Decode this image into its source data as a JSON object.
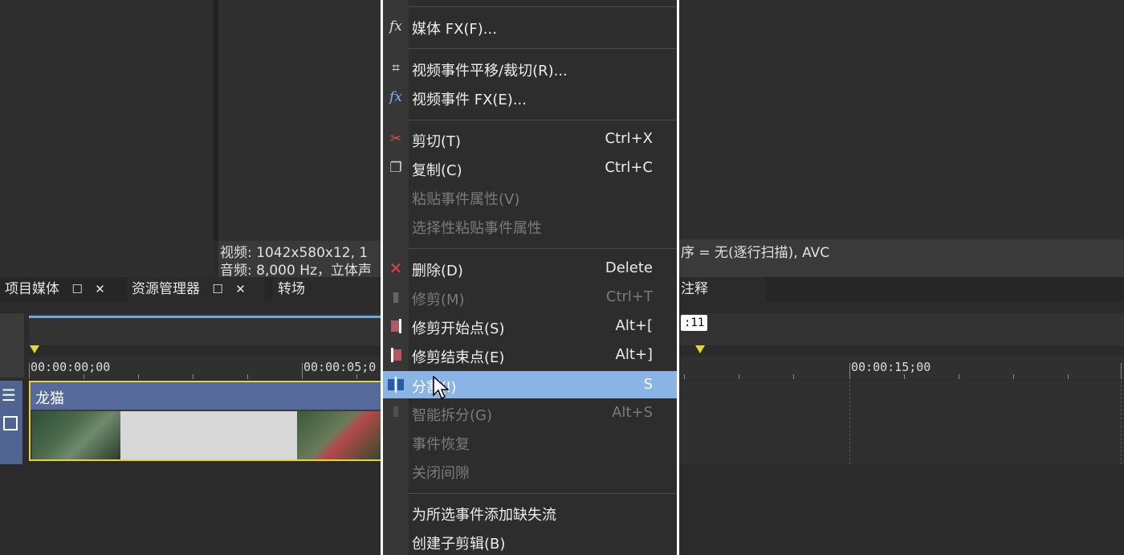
{
  "preview_info": {
    "video_left": "视频: 1042x580x12, 1",
    "audio_left": "音频: 8,000 Hz，立体声",
    "right_text": "序 = 无(逐行扫描), AVC"
  },
  "tabs": {
    "project_media": "项目媒体",
    "explorer": "资源管理器",
    "transitions": "转场",
    "notes": "注释",
    "window_glyph": "☐",
    "close_glyph": "✕"
  },
  "timeline": {
    "tc_start": "00:00:00;00",
    "tc_5": "00:00:05;0",
    "tc_15": "00:00:15;00",
    "cursor_tc": ":11",
    "track_clip_name": "龙猫"
  },
  "menu": {
    "items": [
      {
        "id": "media-fx",
        "label": "媒体 FX(F)...",
        "shortcut": "",
        "disabled": false
      },
      {
        "id": "pan-crop",
        "label": "视频事件平移/裁切(R)...",
        "shortcut": "",
        "disabled": false
      },
      {
        "id": "video-fx",
        "label": "视频事件 FX(E)...",
        "shortcut": "",
        "disabled": false
      },
      {
        "id": "cut",
        "label": "剪切(T)",
        "shortcut": "Ctrl+X",
        "disabled": false
      },
      {
        "id": "copy",
        "label": "复制(C)",
        "shortcut": "Ctrl+C",
        "disabled": false
      },
      {
        "id": "paste-attrs",
        "label": "粘贴事件属性(V)",
        "shortcut": "",
        "disabled": true
      },
      {
        "id": "selective-paste",
        "label": "选择性粘贴事件属性",
        "shortcut": "",
        "disabled": true
      },
      {
        "id": "delete",
        "label": "删除(D)",
        "shortcut": "Delete",
        "disabled": false
      },
      {
        "id": "trim",
        "label": "修剪(M)",
        "shortcut": "Ctrl+T",
        "disabled": true
      },
      {
        "id": "trim-start",
        "label": "修剪开始点(S)",
        "shortcut": "Alt+[",
        "disabled": false
      },
      {
        "id": "trim-end",
        "label": "修剪结束点(E)",
        "shortcut": "Alt+]",
        "disabled": false
      },
      {
        "id": "split",
        "label": "分割(I)",
        "shortcut": "S",
        "disabled": false,
        "highlighted": true
      },
      {
        "id": "smart-split",
        "label": "智能拆分(G)",
        "shortcut": "Alt+S",
        "disabled": true
      },
      {
        "id": "event-restore",
        "label": "事件恢复",
        "shortcut": "",
        "disabled": true
      },
      {
        "id": "close-gap",
        "label": "关闭间隙",
        "shortcut": "",
        "disabled": true
      },
      {
        "id": "add-missing-stream",
        "label": "为所选事件添加缺失流",
        "shortcut": "",
        "disabled": false
      },
      {
        "id": "create-subclip",
        "label": "创建子剪辑(B)",
        "shortcut": "",
        "disabled": false
      }
    ]
  },
  "colors": {
    "highlight": "#8ab4e6",
    "timeline_blue": "#6aa8e8",
    "clip_border": "#e6d23a"
  }
}
